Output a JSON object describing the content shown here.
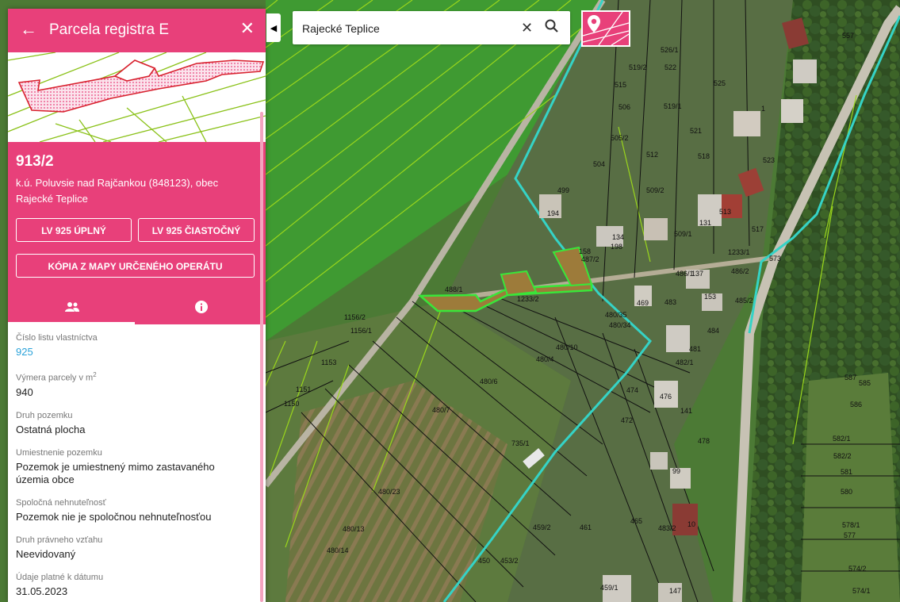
{
  "header": {
    "title": "Parcela registra E",
    "back_icon": "arrow-left-icon",
    "close_icon": "close-icon"
  },
  "parcel": {
    "number": "913/2",
    "location": "k.ú. Poluvsie nad Rajčankou (848123), obec Rajecké Teplice",
    "buttons": {
      "lv_full": "LV 925 ÚPLNÝ",
      "lv_partial": "LV 925 ČIASTOČNÝ",
      "copy_map": "KÓPIA Z MAPY URČENÉHO OPERÁTU"
    },
    "tabs": [
      {
        "icon": "owners-icon"
      },
      {
        "icon": "info-icon"
      }
    ]
  },
  "details": [
    {
      "label": "Číslo listu vlastníctva",
      "value": "925"
    },
    {
      "label": "Výmera parcely v m",
      "label_sup": "2",
      "value": "940"
    },
    {
      "label": "Druh pozemku",
      "value": "Ostatná plocha"
    },
    {
      "label": "Umiestnenie pozemku",
      "value": "Pozemok je umiestnený mimo zastavaného územia obce"
    },
    {
      "label": "Spoločná nehnuteľnosť",
      "value": "Pozemok nie je spoločnou nehnuteľnosťou"
    },
    {
      "label": "Druh právneho vzťahu",
      "value": "Neevidovaný"
    },
    {
      "label": "Údaje platné k dátumu",
      "value": "31.05.2023"
    }
  ],
  "search": {
    "value": "Rajecké Teplice",
    "clear_icon": "close-icon",
    "search_icon": "search-icon"
  },
  "map": {
    "layer_icon": "map-pin-layer-icon",
    "collapse_icon": "chevron-left-icon",
    "labels": [
      "526/1",
      "519/2",
      "522",
      "525",
      "515",
      "519/1",
      "506",
      "521",
      "505/2",
      "504",
      "512",
      "518",
      "523",
      "509/2",
      "509/1",
      "513",
      "131",
      "517",
      "499",
      "194",
      "134",
      "198",
      "158",
      "487/2",
      "1233/1",
      "486/1",
      "137",
      "486/2",
      "153",
      "485/2",
      "469",
      "480/35",
      "480/34",
      "480/10",
      "480/4",
      "480/6",
      "480/7",
      "480/23",
      "480/13",
      "480/14",
      "1151",
      "1150",
      "1153",
      "1156/1",
      "1156/2",
      "488/1",
      "483",
      "1233/2",
      "484",
      "481",
      "482/1",
      "474",
      "476",
      "141",
      "472",
      "478",
      "483/2",
      "459/2",
      "461",
      "99",
      "465",
      "10",
      "147",
      "459/1",
      "450",
      "453/2",
      "735/1",
      "582/1",
      "582/2",
      "581",
      "580",
      "578/1",
      "577",
      "574/2",
      "574/1",
      "585",
      "586",
      "587",
      "573",
      "557",
      "1"
    ],
    "colors": {
      "boundary": "#35d3c6",
      "parcel_highlight": "#39e639",
      "green_lines": "#9ad61c",
      "black_lines": "#111111",
      "pink": "#e8407a"
    }
  }
}
